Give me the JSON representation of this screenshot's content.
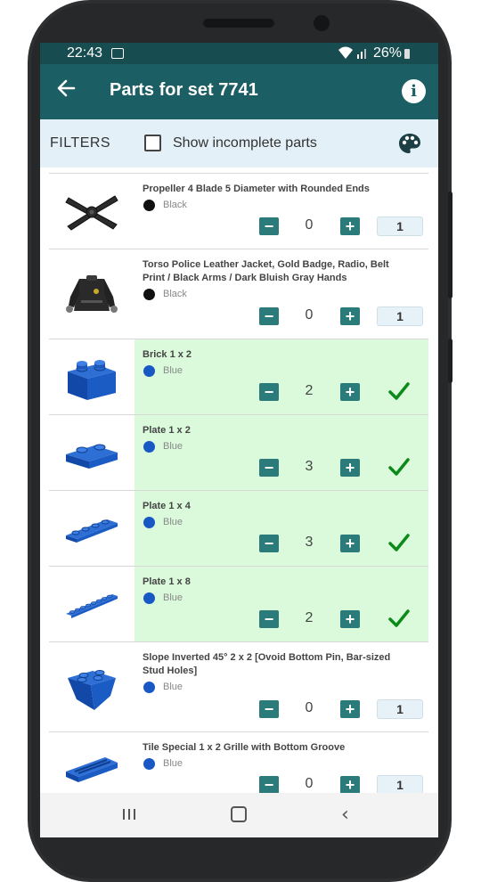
{
  "status": {
    "time": "22:43",
    "battery": "26%"
  },
  "appbar": {
    "title": "Parts for set 7741",
    "back_icon": "arrow-left-icon",
    "info_icon": "info-icon"
  },
  "filters": {
    "label": "FILTERS",
    "checkbox_label": "Show incomplete parts",
    "checked": false,
    "palette_icon": "palette-icon"
  },
  "parts": [
    {
      "name": "Propeller 4 Blade 5 Diameter with Rounded Ends",
      "color": "Black",
      "swatch": "#111111",
      "qty": "0",
      "need": "1",
      "complete": false,
      "img": "propeller"
    },
    {
      "name": "Torso Police Leather Jacket, Gold Badge, Radio, Belt Print / Black Arms / Dark Bluish Gray Hands",
      "color": "Black",
      "swatch": "#111111",
      "qty": "0",
      "need": "1",
      "complete": false,
      "img": "torso"
    },
    {
      "name": "Brick 1 x 2",
      "color": "Blue",
      "swatch": "#1858c4",
      "qty": "2",
      "need": "2",
      "complete": true,
      "img": "brick"
    },
    {
      "name": "Plate 1 x 2",
      "color": "Blue",
      "swatch": "#1858c4",
      "qty": "3",
      "need": "3",
      "complete": true,
      "img": "plate2"
    },
    {
      "name": "Plate 1 x 4",
      "color": "Blue",
      "swatch": "#1858c4",
      "qty": "3",
      "need": "3",
      "complete": true,
      "img": "plate4"
    },
    {
      "name": "Plate 1 x 8",
      "color": "Blue",
      "swatch": "#1858c4",
      "qty": "2",
      "need": "2",
      "complete": true,
      "img": "plate8"
    },
    {
      "name": "Slope Inverted 45° 2 x 2 [Ovoid Bottom Pin, Bar-sized Stud Holes]",
      "color": "Blue",
      "swatch": "#1858c4",
      "qty": "0",
      "need": "1",
      "complete": false,
      "img": "slope"
    },
    {
      "name": "Tile Special 1 x 2 Grille with Bottom Groove",
      "color": "Blue",
      "swatch": "#1858c4",
      "qty": "0",
      "need": "1",
      "complete": false,
      "img": "tile"
    }
  ],
  "labels": {
    "minus": "−",
    "plus": "+"
  },
  "navbar": {
    "recents_icon": "recents-icon",
    "home_icon": "home-icon",
    "back_icon": "back-chevron-icon"
  },
  "colors": {
    "statusbar": "#174d50",
    "appbar": "#1b5e63",
    "button": "#2a7b7a",
    "complete_bg": "#dafadb",
    "filter_bg": "#e3f0f8"
  }
}
